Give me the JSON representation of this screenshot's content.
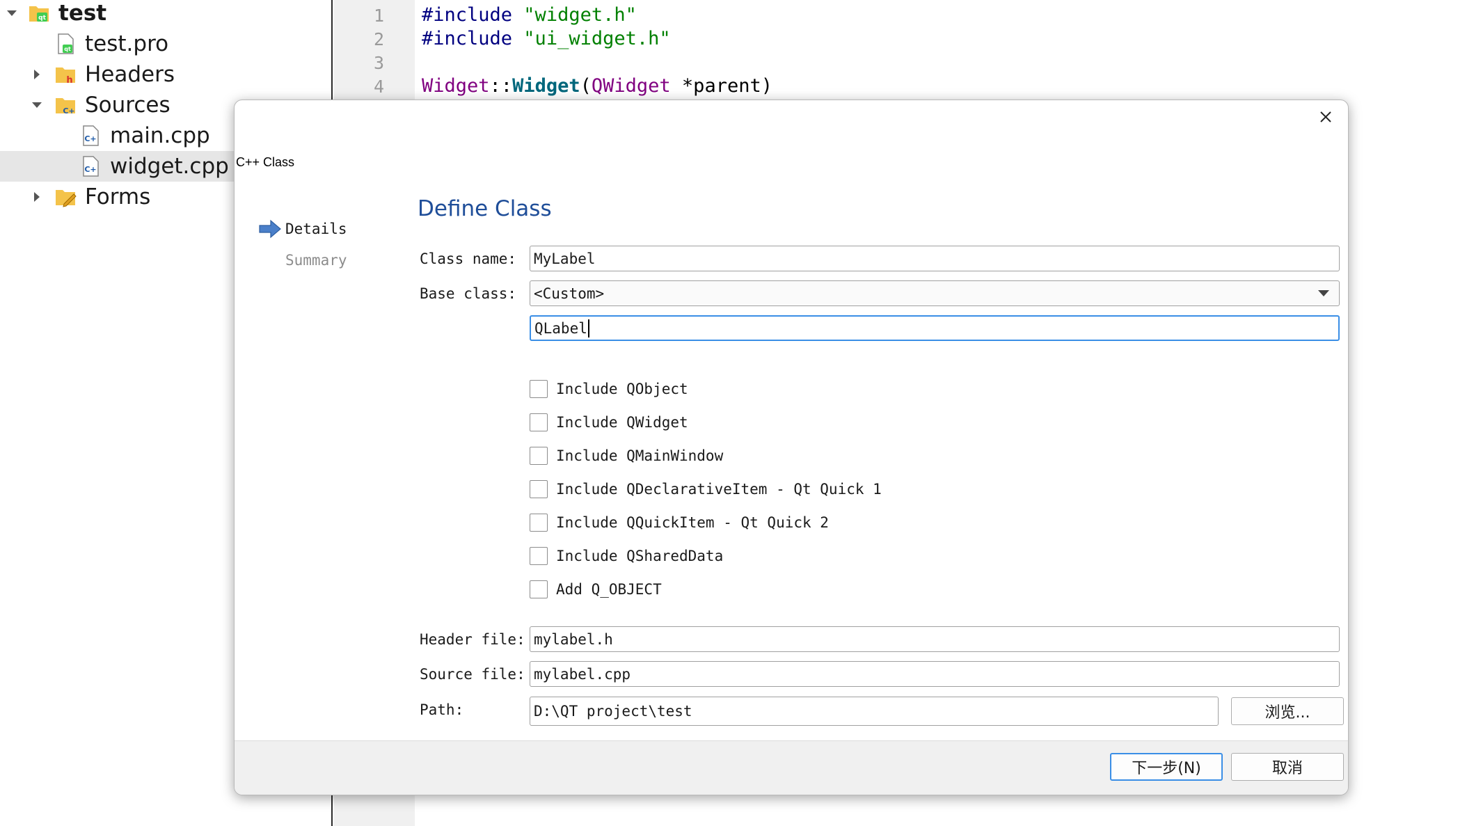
{
  "tree": {
    "items": [
      {
        "label": "test",
        "icon": "qt-project-folder-icon",
        "expander": "expanded"
      },
      {
        "label": "test.pro",
        "icon": "qt-pro-file-icon",
        "expander": "none"
      },
      {
        "label": "Headers",
        "icon": "headers-folder-icon",
        "expander": "collapsed"
      },
      {
        "label": "Sources",
        "icon": "sources-folder-icon",
        "expander": "expanded"
      },
      {
        "label": "main.cpp",
        "icon": "cpp-file-icon",
        "expander": "none"
      },
      {
        "label": "widget.cpp",
        "icon": "cpp-file-icon",
        "expander": "none",
        "selected": true
      },
      {
        "label": "Forms",
        "icon": "forms-folder-icon",
        "expander": "collapsed"
      }
    ]
  },
  "editor": {
    "line_numbers": [
      "1",
      "2",
      "3",
      "4"
    ],
    "lines": [
      {
        "pp": "#include",
        "str": " \"widget.h\""
      },
      {
        "pp": "#include",
        "str": " \"ui_widget.h\""
      },
      {},
      {
        "type1": "Widget",
        "sep": "::",
        "fn": "Widget",
        "open": "(",
        "type2": "QWidget",
        "rest": " *parent)"
      }
    ]
  },
  "dialog": {
    "title": "C++ Class",
    "close_icon": "close-icon",
    "nav": {
      "current": "Details",
      "next": "Summary",
      "current_icon": "arrow-right-icon"
    },
    "heading": "Define Class",
    "class_name": {
      "label": "Class name:",
      "value": "MyLabel"
    },
    "base_class": {
      "label": "Base class:",
      "value": "<Custom>"
    },
    "custom_base": {
      "value": "QLabel"
    },
    "checkboxes": [
      {
        "label": "Include QObject",
        "checked": false
      },
      {
        "label": "Include QWidget",
        "checked": false
      },
      {
        "label": "Include QMainWindow",
        "checked": false
      },
      {
        "label": "Include QDeclarativeItem - Qt Quick 1",
        "checked": false
      },
      {
        "label": "Include QQuickItem - Qt Quick 2",
        "checked": false
      },
      {
        "label": "Include QSharedData",
        "checked": false
      },
      {
        "label": "Add Q_OBJECT",
        "checked": false
      }
    ],
    "header_file": {
      "label": "Header file:",
      "value": "mylabel.h"
    },
    "source_file": {
      "label": "Source file:",
      "value": "mylabel.cpp"
    },
    "path": {
      "label": "Path:",
      "value": "D:\\QT project\\test"
    },
    "browse_label": "浏览...",
    "next_label": "下一步(N)",
    "cancel_label": "取消"
  },
  "colors": {
    "heading": "#1f4e99",
    "focus": "#3a8ee6",
    "nav_arrow": "#4a7fc9"
  }
}
